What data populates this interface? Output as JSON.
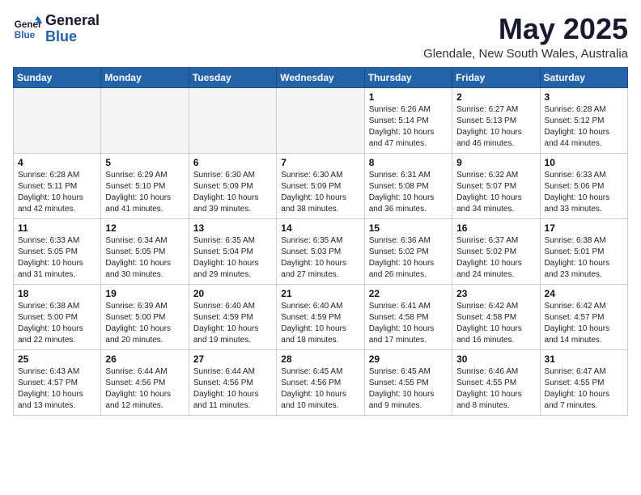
{
  "header": {
    "logo_line1": "General",
    "logo_line2": "Blue",
    "month": "May 2025",
    "location": "Glendale, New South Wales, Australia"
  },
  "weekdays": [
    "Sunday",
    "Monday",
    "Tuesday",
    "Wednesday",
    "Thursday",
    "Friday",
    "Saturday"
  ],
  "weeks": [
    [
      {
        "day": "",
        "info": ""
      },
      {
        "day": "",
        "info": ""
      },
      {
        "day": "",
        "info": ""
      },
      {
        "day": "",
        "info": ""
      },
      {
        "day": "1",
        "info": "Sunrise: 6:26 AM\nSunset: 5:14 PM\nDaylight: 10 hours\nand 47 minutes."
      },
      {
        "day": "2",
        "info": "Sunrise: 6:27 AM\nSunset: 5:13 PM\nDaylight: 10 hours\nand 46 minutes."
      },
      {
        "day": "3",
        "info": "Sunrise: 6:28 AM\nSunset: 5:12 PM\nDaylight: 10 hours\nand 44 minutes."
      }
    ],
    [
      {
        "day": "4",
        "info": "Sunrise: 6:28 AM\nSunset: 5:11 PM\nDaylight: 10 hours\nand 42 minutes."
      },
      {
        "day": "5",
        "info": "Sunrise: 6:29 AM\nSunset: 5:10 PM\nDaylight: 10 hours\nand 41 minutes."
      },
      {
        "day": "6",
        "info": "Sunrise: 6:30 AM\nSunset: 5:09 PM\nDaylight: 10 hours\nand 39 minutes."
      },
      {
        "day": "7",
        "info": "Sunrise: 6:30 AM\nSunset: 5:09 PM\nDaylight: 10 hours\nand 38 minutes."
      },
      {
        "day": "8",
        "info": "Sunrise: 6:31 AM\nSunset: 5:08 PM\nDaylight: 10 hours\nand 36 minutes."
      },
      {
        "day": "9",
        "info": "Sunrise: 6:32 AM\nSunset: 5:07 PM\nDaylight: 10 hours\nand 34 minutes."
      },
      {
        "day": "10",
        "info": "Sunrise: 6:33 AM\nSunset: 5:06 PM\nDaylight: 10 hours\nand 33 minutes."
      }
    ],
    [
      {
        "day": "11",
        "info": "Sunrise: 6:33 AM\nSunset: 5:05 PM\nDaylight: 10 hours\nand 31 minutes."
      },
      {
        "day": "12",
        "info": "Sunrise: 6:34 AM\nSunset: 5:05 PM\nDaylight: 10 hours\nand 30 minutes."
      },
      {
        "day": "13",
        "info": "Sunrise: 6:35 AM\nSunset: 5:04 PM\nDaylight: 10 hours\nand 29 minutes."
      },
      {
        "day": "14",
        "info": "Sunrise: 6:35 AM\nSunset: 5:03 PM\nDaylight: 10 hours\nand 27 minutes."
      },
      {
        "day": "15",
        "info": "Sunrise: 6:36 AM\nSunset: 5:02 PM\nDaylight: 10 hours\nand 26 minutes."
      },
      {
        "day": "16",
        "info": "Sunrise: 6:37 AM\nSunset: 5:02 PM\nDaylight: 10 hours\nand 24 minutes."
      },
      {
        "day": "17",
        "info": "Sunrise: 6:38 AM\nSunset: 5:01 PM\nDaylight: 10 hours\nand 23 minutes."
      }
    ],
    [
      {
        "day": "18",
        "info": "Sunrise: 6:38 AM\nSunset: 5:00 PM\nDaylight: 10 hours\nand 22 minutes."
      },
      {
        "day": "19",
        "info": "Sunrise: 6:39 AM\nSunset: 5:00 PM\nDaylight: 10 hours\nand 20 minutes."
      },
      {
        "day": "20",
        "info": "Sunrise: 6:40 AM\nSunset: 4:59 PM\nDaylight: 10 hours\nand 19 minutes."
      },
      {
        "day": "21",
        "info": "Sunrise: 6:40 AM\nSunset: 4:59 PM\nDaylight: 10 hours\nand 18 minutes."
      },
      {
        "day": "22",
        "info": "Sunrise: 6:41 AM\nSunset: 4:58 PM\nDaylight: 10 hours\nand 17 minutes."
      },
      {
        "day": "23",
        "info": "Sunrise: 6:42 AM\nSunset: 4:58 PM\nDaylight: 10 hours\nand 16 minutes."
      },
      {
        "day": "24",
        "info": "Sunrise: 6:42 AM\nSunset: 4:57 PM\nDaylight: 10 hours\nand 14 minutes."
      }
    ],
    [
      {
        "day": "25",
        "info": "Sunrise: 6:43 AM\nSunset: 4:57 PM\nDaylight: 10 hours\nand 13 minutes."
      },
      {
        "day": "26",
        "info": "Sunrise: 6:44 AM\nSunset: 4:56 PM\nDaylight: 10 hours\nand 12 minutes."
      },
      {
        "day": "27",
        "info": "Sunrise: 6:44 AM\nSunset: 4:56 PM\nDaylight: 10 hours\nand 11 minutes."
      },
      {
        "day": "28",
        "info": "Sunrise: 6:45 AM\nSunset: 4:56 PM\nDaylight: 10 hours\nand 10 minutes."
      },
      {
        "day": "29",
        "info": "Sunrise: 6:45 AM\nSunset: 4:55 PM\nDaylight: 10 hours\nand 9 minutes."
      },
      {
        "day": "30",
        "info": "Sunrise: 6:46 AM\nSunset: 4:55 PM\nDaylight: 10 hours\nand 8 minutes."
      },
      {
        "day": "31",
        "info": "Sunrise: 6:47 AM\nSunset: 4:55 PM\nDaylight: 10 hours\nand 7 minutes."
      }
    ]
  ]
}
